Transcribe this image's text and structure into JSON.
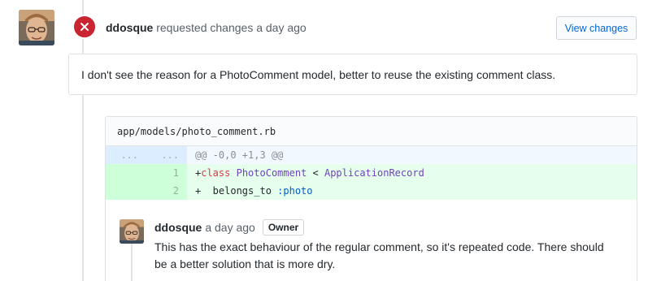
{
  "review": {
    "author": "ddosque",
    "action": "requested changes a day ago",
    "view_changes_label": "View changes",
    "body": "I don't see the reason for a PhotoComment model, better to reuse the existing comment class.",
    "status_color": "#cb2431"
  },
  "file": {
    "path": "app/models/photo_comment.rb",
    "hunk": {
      "left_num": "...",
      "right_num": "...",
      "text": "@@ -0,0 +1,3 @@"
    },
    "lines": [
      {
        "num": "1",
        "prefix": "+",
        "parts": [
          {
            "text": "class",
            "kind": "kw"
          },
          {
            "text": " ",
            "kind": "plain"
          },
          {
            "text": "PhotoComment",
            "kind": "cls"
          },
          {
            "text": " < ",
            "kind": "plain"
          },
          {
            "text": "ApplicationRecord",
            "kind": "cls"
          }
        ]
      },
      {
        "num": "2",
        "prefix": "+",
        "parts": [
          {
            "text": "  belongs_to ",
            "kind": "plain"
          },
          {
            "text": ":photo",
            "kind": "sym"
          }
        ]
      }
    ]
  },
  "comment": {
    "author": "ddosque",
    "time": "a day ago",
    "badge": "Owner",
    "body": "This has the exact behaviour of the regular comment, so it's repeated code. There should be a better solution that is more dry."
  }
}
